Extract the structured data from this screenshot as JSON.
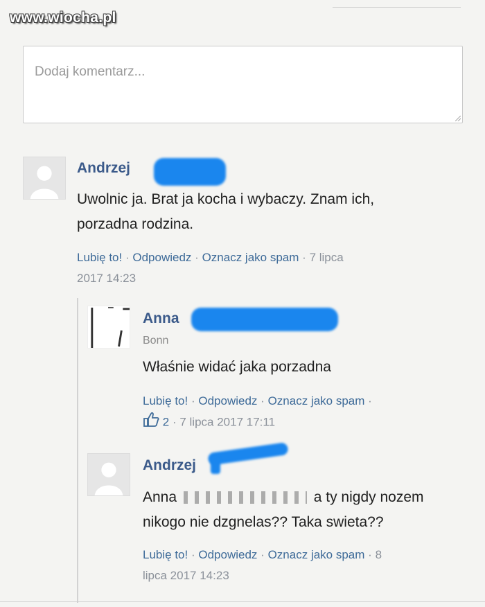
{
  "watermark": "www.wiocha.pl",
  "comment_box": {
    "placeholder": "Dodaj komentarz..."
  },
  "comments": [
    {
      "author": "Andrzej",
      "text_line1": "Uwolnic ja. Brat ja kocha i wybaczy. Znam ich,",
      "text_line2": "porzadna rodzina.",
      "like": "Lubię to!",
      "reply": "Odpowiedz",
      "spam": "Oznacz jako spam",
      "date_part1": "7 lipca",
      "date_part2": "2017 14:23"
    },
    {
      "author": "Anna",
      "location": "Bonn",
      "text_line1": "Właśnie widać jaka porzadna",
      "like": "Lubię to!",
      "reply": "Odpowiedz",
      "spam": "Oznacz jako spam",
      "likes_count": "2",
      "date": "7 lipca 2017 17:11"
    },
    {
      "author": "Andrzej",
      "text_line1_start": "Anna",
      "text_line1_end": "a ty nigdy nozem",
      "text_line2": "nikogo nie dzgnelas?? Taka swieta??",
      "like": "Lubię to!",
      "reply": "Odpowiedz",
      "spam": "Oznacz jako spam",
      "date_part1": "8",
      "date_part2": "lipca 2017 14:23"
    }
  ],
  "separator": "·",
  "colors": {
    "link": "#3d6a98",
    "author": "#3b5a8a",
    "redaction": "#1a86ee"
  }
}
